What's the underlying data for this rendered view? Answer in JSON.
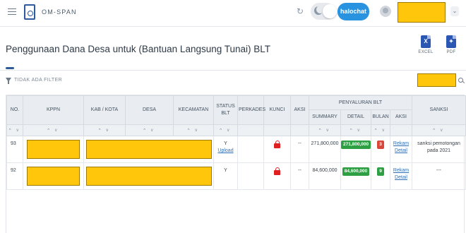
{
  "header": {
    "brand": "OM-SPAN",
    "halochat_label": "halochat"
  },
  "page": {
    "title": "Penggunaan Dana Desa untuk (Bantuan Langsung Tunai) BLT",
    "export_excel_label": "EXCEL",
    "export_pdf_label": "PDF",
    "filter_label": "TIDAK ADA FILTER"
  },
  "table": {
    "headers": {
      "no": "NO.",
      "kppn": "KPPN",
      "kab_kota": "KAB / KOTA",
      "desa": "DESA",
      "kecamatan": "KECAMATAN",
      "status_blt": "STATUS BLT",
      "perkades": "PERKADES",
      "kunci": "KUNCI",
      "aksi": "AKSI",
      "penyaluran_blt": "PENYALURAN BLT",
      "summary": "SUMMARY",
      "detail": "DETAIL",
      "bulan": "BULAN",
      "aksi2": "AKSI",
      "sanksi": "SANKSI"
    },
    "sort_glyph": "^ v",
    "rows": [
      {
        "no": "93",
        "status": "Y",
        "upload": "Upload",
        "aksi": "--",
        "summary": "271,800,000",
        "detail": "271,800,000",
        "bulan": "3",
        "rekam": "Rekam",
        "detail_link": "Detail",
        "sanksi": "sanksi pemotongan pada 2021"
      },
      {
        "no": "92",
        "status": "Y",
        "upload": "",
        "aksi": "--",
        "summary": "84,600,000",
        "detail": "84,600,000",
        "bulan": "9",
        "rekam": "Rekam",
        "detail_link": "Detail",
        "sanksi": "---"
      }
    ]
  },
  "colors": {
    "accent": "#2c5a9c",
    "halochat": "#2a93e0",
    "redaction": "#ffc60b",
    "badge_green": "#2ea043",
    "badge_red": "#d9473b",
    "lock_red": "#e02020"
  },
  "icons": [
    "menu-icon",
    "app-logo-icon",
    "reload-icon",
    "moon-icon",
    "avatar-icon",
    "chevron-down-icon",
    "excel-icon",
    "pdf-icon",
    "filter-icon",
    "search-icon",
    "lock-icon"
  ]
}
